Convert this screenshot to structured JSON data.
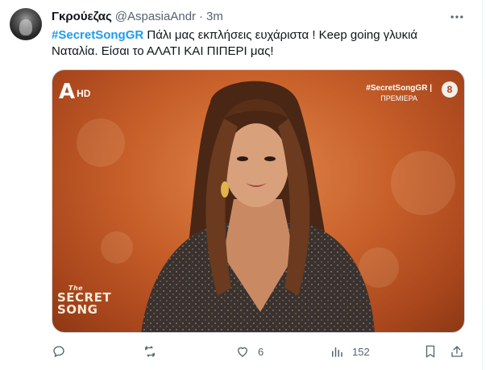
{
  "tweet": {
    "display_name": "Γκρούεζας",
    "handle": "@AspasiaAndr",
    "separator": "·",
    "time": "3m",
    "hashtag": "#SecretSongGR",
    "text_rest": " Πάλι μας εκπλήσεις ευχάριστα ! Keep going γλυκιά Ναταλία. Είσαι το ΑΛΑΤΙ ΚΑΙ ΠΙΠΕΡΙ μας!"
  },
  "media": {
    "channel_logo_letter": "A",
    "channel_logo_hd": "HD",
    "overlay_hashtag": "#SecretSongGR |",
    "overlay_label": "ΠΡΕΜΙΕΡΑ",
    "rating": "8",
    "show_logo_the": "The",
    "show_logo_line1": "SECRET",
    "show_logo_line2": "SONG"
  },
  "actions": {
    "reply_count": "",
    "retweet_count": "",
    "like_count": "6",
    "views_count": "152"
  },
  "icons": [
    "more-icon",
    "reply-icon",
    "retweet-icon",
    "like-icon",
    "views-icon",
    "bookmark-icon",
    "share-icon"
  ],
  "colors": {
    "hashtag": "#1d9bf0",
    "secondary_text": "#536471",
    "background_orange": "#c8602a"
  }
}
